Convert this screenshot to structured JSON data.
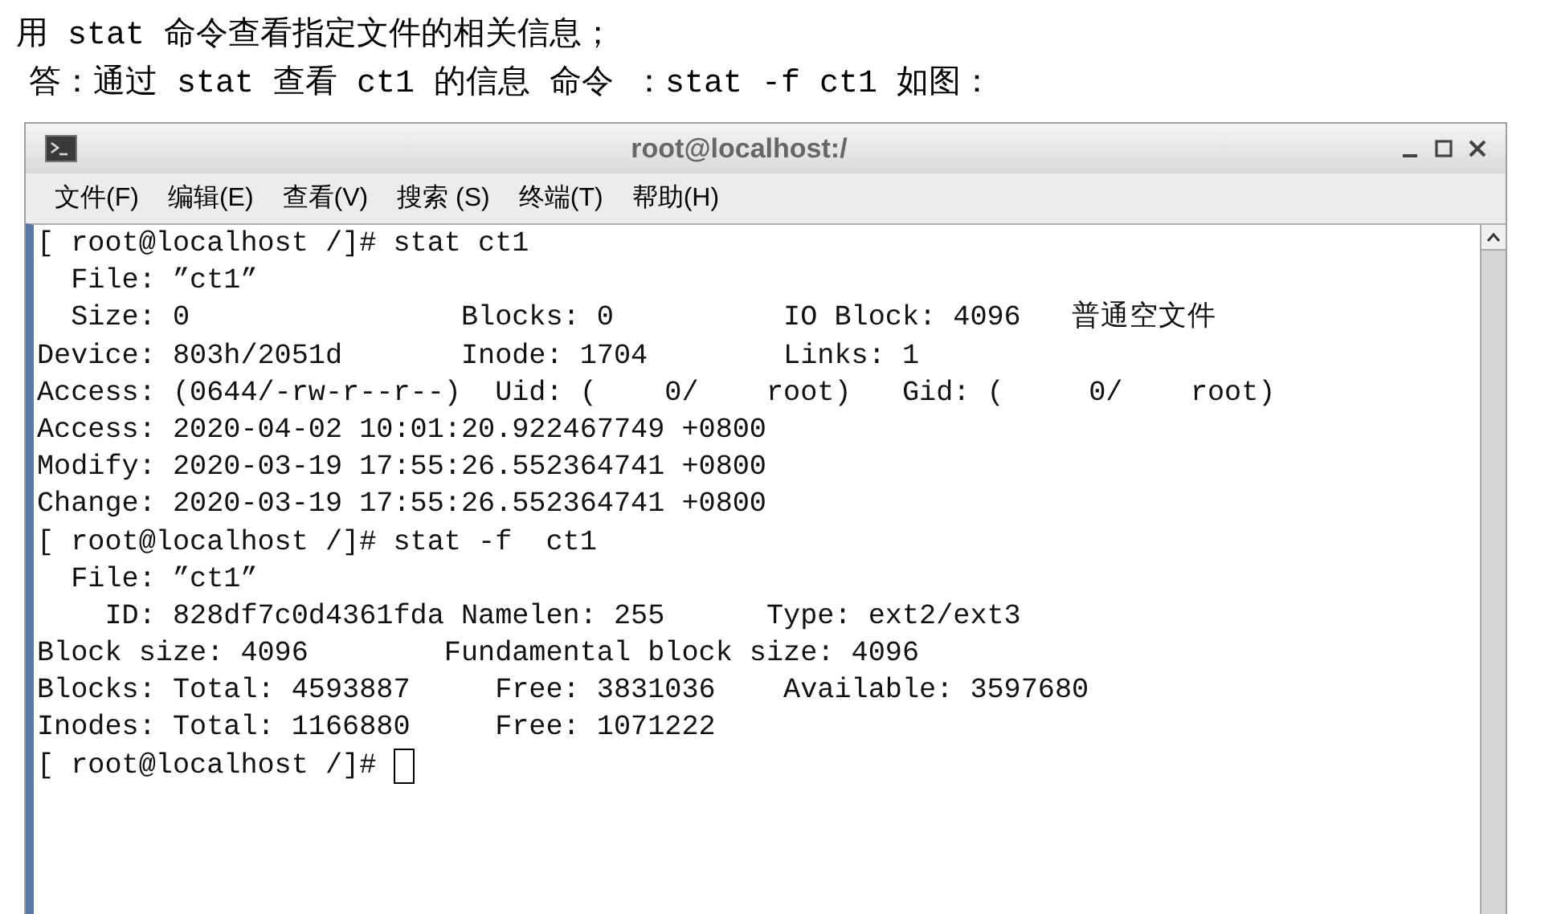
{
  "document": {
    "paragraphs": [
      "用 stat 命令查看指定文件的相关信息；",
      "答：通过 stat 查看 ct1 的信息 命令 ：stat -f ct1 如图："
    ]
  },
  "window": {
    "title": "root@localhost:/",
    "menu": [
      "文件(F)",
      "编辑(E)",
      "查看(V)",
      "搜索 (S)",
      "终端(T)",
      "帮助(H)"
    ],
    "terminal": {
      "lines": [
        "[ root@localhost /]# stat ct1",
        "  File: ”ct1”",
        "  Size: 0                Blocks: 0          IO Block: 4096   普通空文件",
        "Device: 803h/2051d       Inode: 1704        Links: 1",
        "Access: (0644/-rw-r--r--)  Uid: (    0/    root)   Gid: (     0/    root)",
        "Access: 2020-04-02 10:01:20.922467749 +0800",
        "Modify: 2020-03-19 17:55:26.552364741 +0800",
        "Change: 2020-03-19 17:55:26.552364741 +0800",
        "[ root@localhost /]# stat -f  ct1",
        "  File: ”ct1”",
        "    ID: 828df7c0d4361fda Namelen: 255      Type: ext2/ext3",
        "Block size: 4096        Fundamental block size: 4096",
        "Blocks: Total: 4593887     Free: 3831036    Available: 3597680",
        "Inodes: Total: 1166880     Free: 1071222",
        "[ root@localhost /]# "
      ],
      "cursor": true
    }
  }
}
